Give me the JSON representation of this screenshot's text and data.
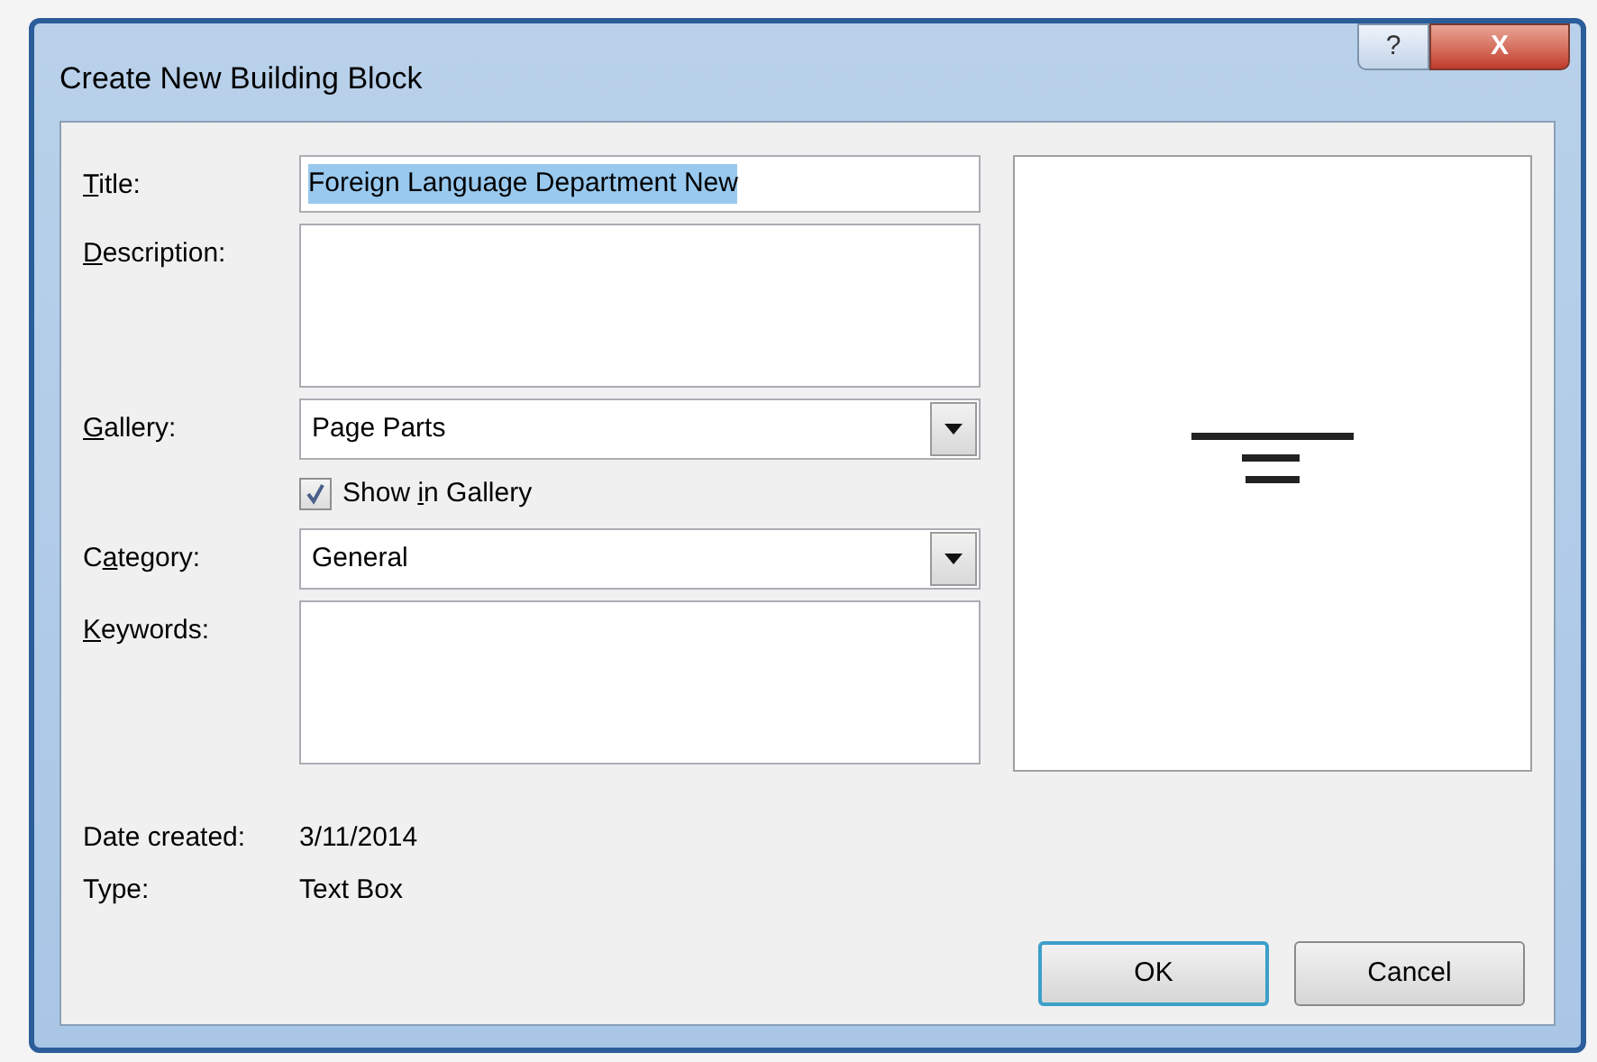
{
  "window": {
    "title": "Create New Building Block",
    "buttons": [
      {
        "kind": "help",
        "label": "?"
      },
      {
        "kind": "close",
        "label": "X"
      }
    ]
  },
  "fields": [
    {
      "kind": "text",
      "label": {
        "key": "T",
        "after": "itle:"
      },
      "value": "Foreign Language Department New",
      "selected": true
    },
    {
      "kind": "area",
      "label": {
        "key": "D",
        "after": "escription:"
      }
    },
    {
      "kind": "dropdown",
      "label": {
        "key": "G",
        "after": "allery:"
      },
      "value": "Page Parts"
    },
    {
      "kind": "checkbox",
      "label": {
        "before": "Show ",
        "key": "i",
        "after": "n Gallery"
      },
      "checked": true
    },
    {
      "kind": "dropdown",
      "label": {
        "before": "C",
        "key": "a",
        "after": "tegory:"
      },
      "value": "General"
    },
    {
      "kind": "area",
      "label": {
        "key": "K",
        "after": "eywords:"
      }
    }
  ],
  "info": [
    {
      "label": "Date created:",
      "value": "3/11/2014"
    },
    {
      "label": "Type:",
      "value": "Text Box"
    }
  ],
  "buttons": [
    {
      "label": "OK",
      "default": true
    },
    {
      "label": "Cancel",
      "default": false
    }
  ]
}
